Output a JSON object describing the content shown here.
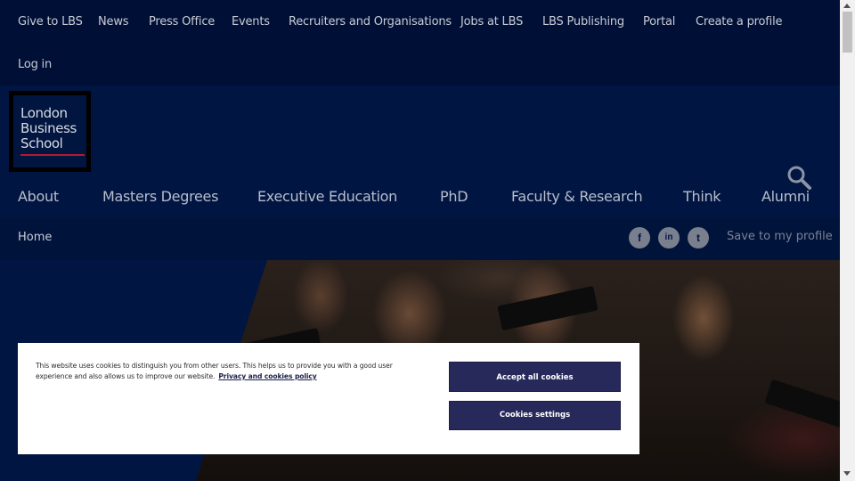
{
  "utility_nav": {
    "items": [
      "Give to LBS",
      "News",
      "Press Office",
      "Events",
      "Recruiters and Organisations",
      "Jobs at LBS",
      "LBS Publishing",
      "Portal",
      "Create a profile"
    ],
    "login": "Log in"
  },
  "logo": {
    "lines": [
      "London",
      "Business",
      "School"
    ]
  },
  "main_nav": [
    "About",
    "Masters Degrees",
    "Executive Education",
    "PhD",
    "Faculty & Research",
    "Think",
    "Alumni"
  ],
  "breadcrumb": {
    "home": "Home"
  },
  "social": {
    "facebook": "f",
    "linkedin": "in",
    "twitter": "t"
  },
  "save_profile": "Save to my profile",
  "cookie": {
    "text": "This website uses cookies to distinguish you from other users. This helps us to provide you with a good user experience and also allows us to improve our website.",
    "link": "Privacy and cookies policy",
    "accept": "Accept all cookies",
    "settings": "Cookies settings"
  },
  "colors": {
    "brand_navy": "#001541",
    "button": "#27295a",
    "accent_red": "#b01c2e"
  }
}
